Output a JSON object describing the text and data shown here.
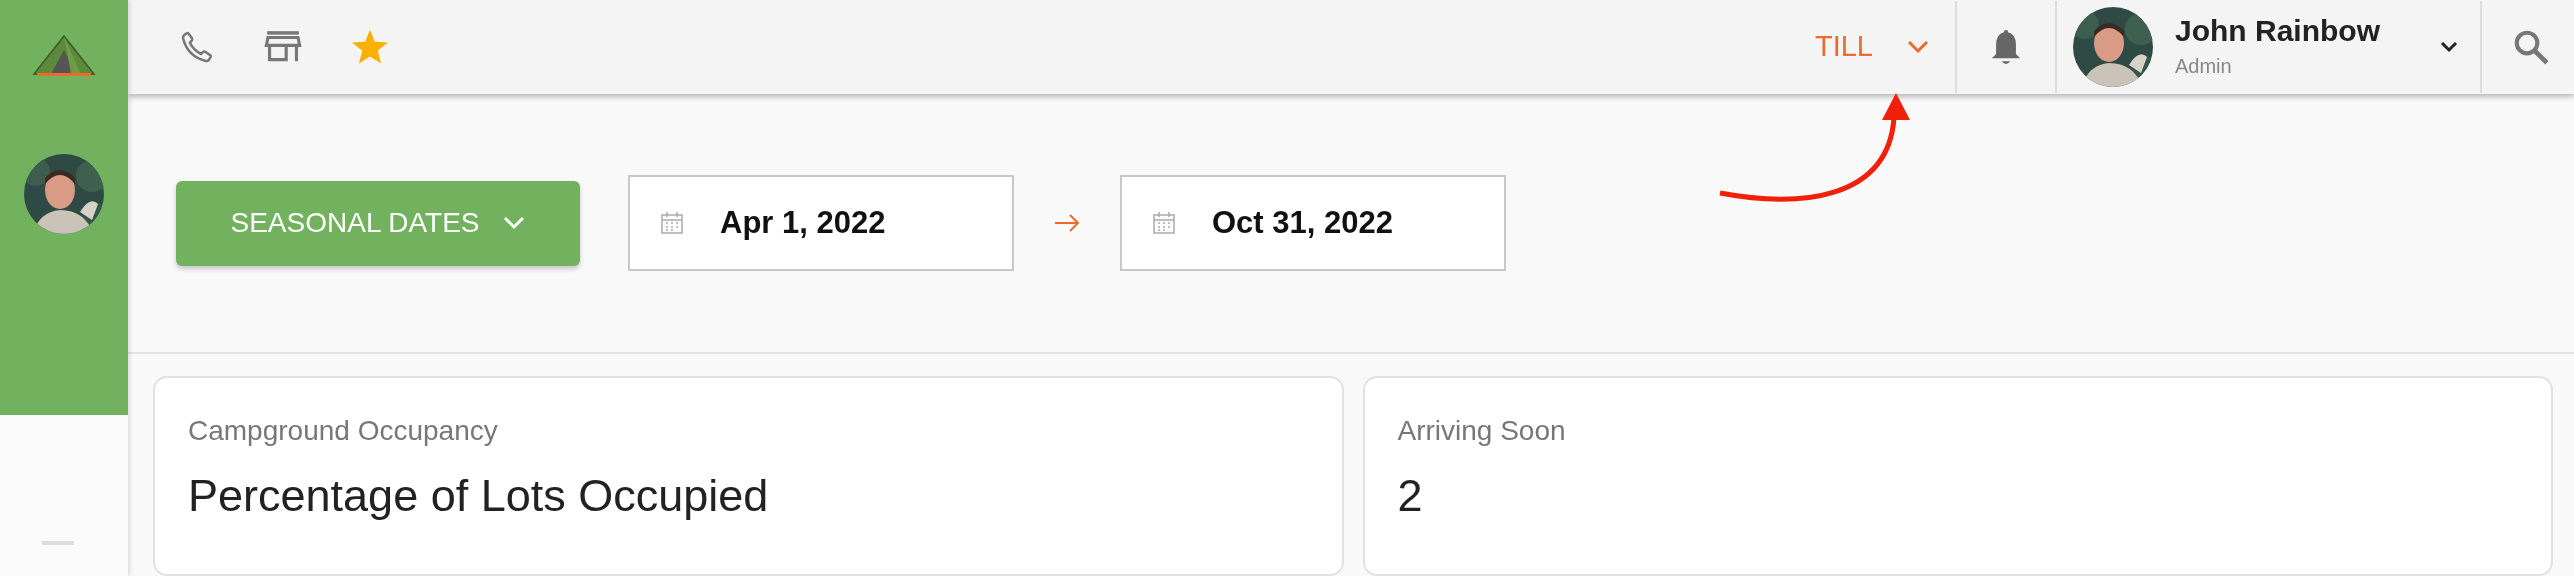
{
  "header": {
    "till": {
      "label": "TILL"
    },
    "user": {
      "name": "John Rainbow",
      "role": "Admin"
    }
  },
  "filter": {
    "label": "SEASONAL DATES"
  },
  "date_range": {
    "start": "Apr 1, 2022",
    "end": "Oct 31, 2022"
  },
  "cards": [
    {
      "title": "Campground Occupancy",
      "value": "Percentage of Lots Occupied"
    },
    {
      "title": "Arriving Soon",
      "value": "2"
    }
  ]
}
